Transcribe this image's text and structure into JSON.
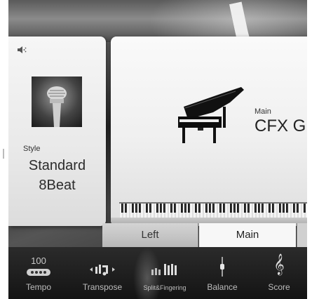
{
  "style_panel": {
    "caption": "Style",
    "name_line1": "Standard",
    "name_line2": "8Beat",
    "speaker_icon": "speaker-icon",
    "thumbnail_icon": "microphone-icon"
  },
  "voice_panel": {
    "caption": "Main",
    "name": "CFX G",
    "image_icon": "grand-piano-icon"
  },
  "part_tabs": {
    "left": "Left",
    "main": "Main"
  },
  "bottom_bar": {
    "tempo": {
      "value": "100",
      "label": "Tempo",
      "icon": "metronome-dots-icon"
    },
    "transpose": {
      "label": "Transpose",
      "icon": "transpose-icon"
    },
    "split": {
      "label": "Split&Fingering",
      "icon": "keyboard-split-icon"
    },
    "balance": {
      "label": "Balance",
      "icon": "balance-slider-icon"
    },
    "score": {
      "label": "Score",
      "icon": "treble-clef-icon"
    }
  }
}
